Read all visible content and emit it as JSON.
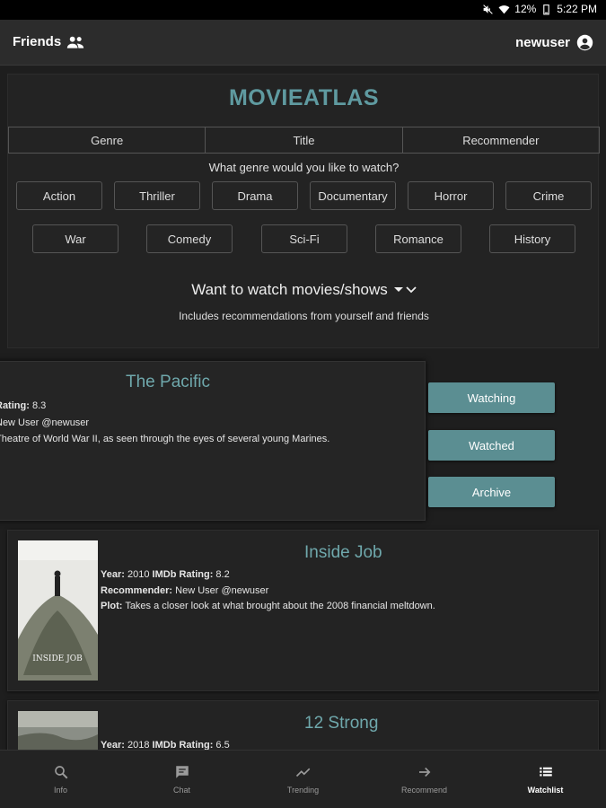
{
  "status": {
    "battery": "12%",
    "time": "5:22 PM"
  },
  "appbar": {
    "friends_label": "Friends",
    "user_label": "newuser"
  },
  "brand": {
    "name": "MOVIEATLAS",
    "color": "#5f9aa0"
  },
  "tabs": [
    {
      "label": "Genre"
    },
    {
      "label": "Title"
    },
    {
      "label": "Recommender"
    }
  ],
  "genre": {
    "question": "What genre would you like to watch?",
    "row1": [
      "Action",
      "Thriller",
      "Drama",
      "Documentary",
      "Horror",
      "Crime"
    ],
    "row2": [
      "War",
      "Comedy",
      "Sci-Fi",
      "Romance",
      "History"
    ]
  },
  "watchlist": {
    "dropdown_label": "Want to watch movies/shows",
    "subtitle": "Includes recommendations from yourself and friends"
  },
  "active_card": {
    "title": "The Pacific",
    "rating_label": "Rating:",
    "rating": "8.3",
    "recommender": "New User @newuser",
    "plot": "Theatre of World War II, as seen through the eyes of several young Marines."
  },
  "actions": {
    "watching": "Watching",
    "watched": "Watched",
    "archive": "Archive",
    "color": "#5b8e92"
  },
  "cards": [
    {
      "title": "Inside Job",
      "year_label": "Year:",
      "year": "2010",
      "imdb_label": "IMDb Rating:",
      "imdb": "8.2",
      "recommender_label": "Recommender:",
      "recommender": "New User @newuser",
      "plot_label": "Plot:",
      "plot": "Takes a closer look at what brought about the 2008 financial meltdown.",
      "poster_text": "INSIDE JOB"
    },
    {
      "title": "12 Strong",
      "year_label": "Year:",
      "year": "2018",
      "imdb_label": "IMDb Rating:",
      "imdb": "6.5"
    }
  ],
  "bottomnav": [
    {
      "label": "Info",
      "icon": "search-icon"
    },
    {
      "label": "Chat",
      "icon": "chat-icon"
    },
    {
      "label": "Trending",
      "icon": "trending-icon"
    },
    {
      "label": "Recommend",
      "icon": "arrow-forward-icon"
    },
    {
      "label": "Watchlist",
      "icon": "list-icon"
    }
  ]
}
